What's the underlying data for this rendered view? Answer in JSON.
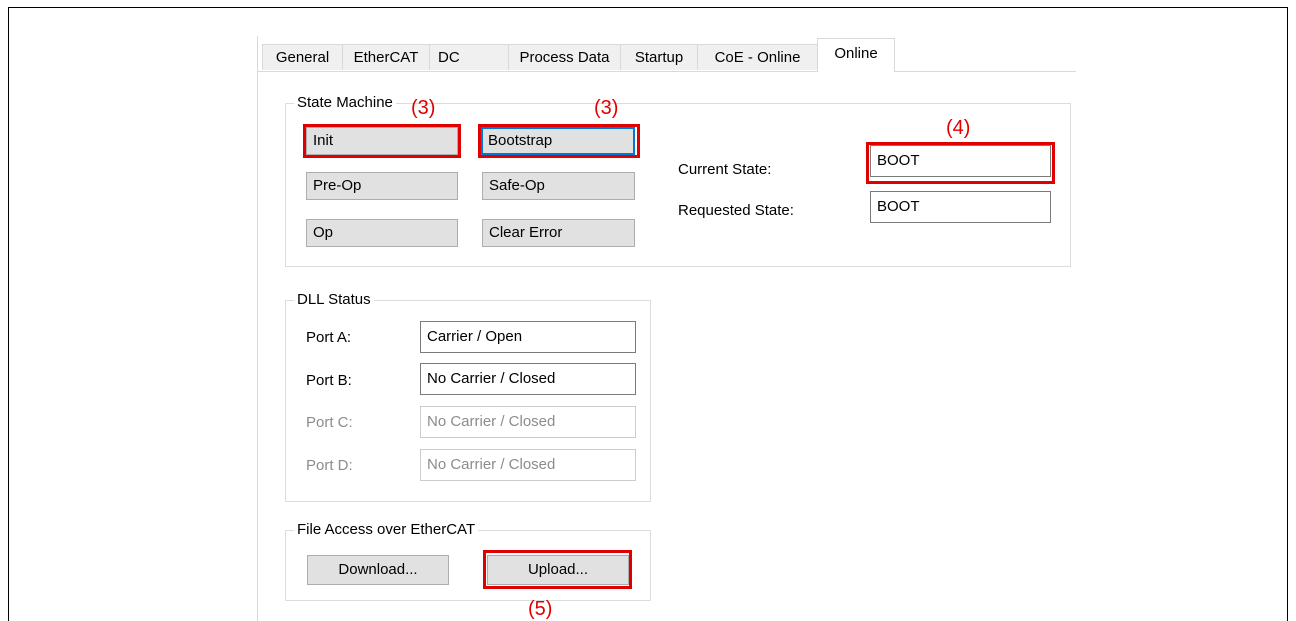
{
  "tabs": [
    {
      "label": "General"
    },
    {
      "label": "EtherCAT"
    },
    {
      "label": "DC"
    },
    {
      "label": "Process Data"
    },
    {
      "label": "Startup"
    },
    {
      "label": "CoE - Online"
    },
    {
      "label": "Online"
    }
  ],
  "state_machine": {
    "title": "State Machine",
    "buttons": {
      "init": "Init",
      "bootstrap": "Bootstrap",
      "pre_op": "Pre-Op",
      "safe_op": "Safe-Op",
      "op": "Op",
      "clear_error": "Clear Error"
    },
    "current_state_label": "Current State:",
    "current_state_value": "BOOT",
    "requested_state_label": "Requested State:",
    "requested_state_value": "BOOT"
  },
  "dll_status": {
    "title": "DLL Status",
    "ports": [
      {
        "label": "Port A:",
        "value": "Carrier / Open"
      },
      {
        "label": "Port B:",
        "value": "No Carrier / Closed"
      },
      {
        "label": "Port C:",
        "value": "No Carrier / Closed"
      },
      {
        "label": "Port D:",
        "value": "No Carrier / Closed"
      }
    ]
  },
  "file_access": {
    "title": "File Access over EtherCAT",
    "download_label": "Download...",
    "upload_label": "Upload..."
  },
  "annotations": {
    "init_note": "(3)",
    "bootstrap_note": "(3)",
    "current_state_note": "(4)",
    "upload_note": "(5)",
    "color": "#e00000"
  }
}
